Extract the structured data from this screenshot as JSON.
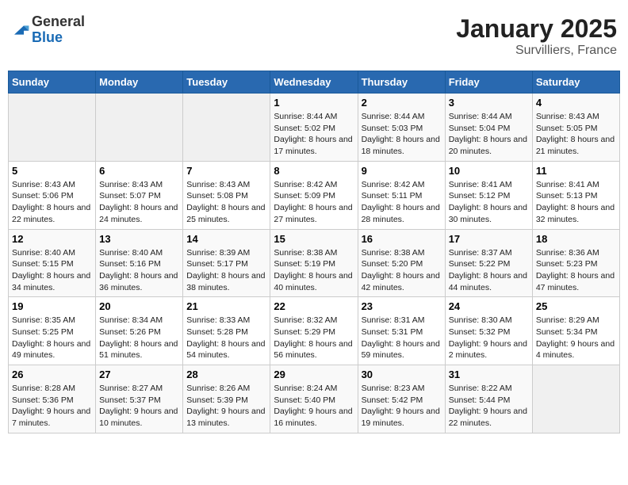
{
  "logo": {
    "line1": "General",
    "line2": "Blue"
  },
  "title": "January 2025",
  "subtitle": "Survilliers, France",
  "weekdays": [
    "Sunday",
    "Monday",
    "Tuesday",
    "Wednesday",
    "Thursday",
    "Friday",
    "Saturday"
  ],
  "weeks": [
    [
      {
        "num": "",
        "info": ""
      },
      {
        "num": "",
        "info": ""
      },
      {
        "num": "",
        "info": ""
      },
      {
        "num": "1",
        "info": "Sunrise: 8:44 AM\nSunset: 5:02 PM\nDaylight: 8 hours and 17 minutes."
      },
      {
        "num": "2",
        "info": "Sunrise: 8:44 AM\nSunset: 5:03 PM\nDaylight: 8 hours and 18 minutes."
      },
      {
        "num": "3",
        "info": "Sunrise: 8:44 AM\nSunset: 5:04 PM\nDaylight: 8 hours and 20 minutes."
      },
      {
        "num": "4",
        "info": "Sunrise: 8:43 AM\nSunset: 5:05 PM\nDaylight: 8 hours and 21 minutes."
      }
    ],
    [
      {
        "num": "5",
        "info": "Sunrise: 8:43 AM\nSunset: 5:06 PM\nDaylight: 8 hours and 22 minutes."
      },
      {
        "num": "6",
        "info": "Sunrise: 8:43 AM\nSunset: 5:07 PM\nDaylight: 8 hours and 24 minutes."
      },
      {
        "num": "7",
        "info": "Sunrise: 8:43 AM\nSunset: 5:08 PM\nDaylight: 8 hours and 25 minutes."
      },
      {
        "num": "8",
        "info": "Sunrise: 8:42 AM\nSunset: 5:09 PM\nDaylight: 8 hours and 27 minutes."
      },
      {
        "num": "9",
        "info": "Sunrise: 8:42 AM\nSunset: 5:11 PM\nDaylight: 8 hours and 28 minutes."
      },
      {
        "num": "10",
        "info": "Sunrise: 8:41 AM\nSunset: 5:12 PM\nDaylight: 8 hours and 30 minutes."
      },
      {
        "num": "11",
        "info": "Sunrise: 8:41 AM\nSunset: 5:13 PM\nDaylight: 8 hours and 32 minutes."
      }
    ],
    [
      {
        "num": "12",
        "info": "Sunrise: 8:40 AM\nSunset: 5:15 PM\nDaylight: 8 hours and 34 minutes."
      },
      {
        "num": "13",
        "info": "Sunrise: 8:40 AM\nSunset: 5:16 PM\nDaylight: 8 hours and 36 minutes."
      },
      {
        "num": "14",
        "info": "Sunrise: 8:39 AM\nSunset: 5:17 PM\nDaylight: 8 hours and 38 minutes."
      },
      {
        "num": "15",
        "info": "Sunrise: 8:38 AM\nSunset: 5:19 PM\nDaylight: 8 hours and 40 minutes."
      },
      {
        "num": "16",
        "info": "Sunrise: 8:38 AM\nSunset: 5:20 PM\nDaylight: 8 hours and 42 minutes."
      },
      {
        "num": "17",
        "info": "Sunrise: 8:37 AM\nSunset: 5:22 PM\nDaylight: 8 hours and 44 minutes."
      },
      {
        "num": "18",
        "info": "Sunrise: 8:36 AM\nSunset: 5:23 PM\nDaylight: 8 hours and 47 minutes."
      }
    ],
    [
      {
        "num": "19",
        "info": "Sunrise: 8:35 AM\nSunset: 5:25 PM\nDaylight: 8 hours and 49 minutes."
      },
      {
        "num": "20",
        "info": "Sunrise: 8:34 AM\nSunset: 5:26 PM\nDaylight: 8 hours and 51 minutes."
      },
      {
        "num": "21",
        "info": "Sunrise: 8:33 AM\nSunset: 5:28 PM\nDaylight: 8 hours and 54 minutes."
      },
      {
        "num": "22",
        "info": "Sunrise: 8:32 AM\nSunset: 5:29 PM\nDaylight: 8 hours and 56 minutes."
      },
      {
        "num": "23",
        "info": "Sunrise: 8:31 AM\nSunset: 5:31 PM\nDaylight: 8 hours and 59 minutes."
      },
      {
        "num": "24",
        "info": "Sunrise: 8:30 AM\nSunset: 5:32 PM\nDaylight: 9 hours and 2 minutes."
      },
      {
        "num": "25",
        "info": "Sunrise: 8:29 AM\nSunset: 5:34 PM\nDaylight: 9 hours and 4 minutes."
      }
    ],
    [
      {
        "num": "26",
        "info": "Sunrise: 8:28 AM\nSunset: 5:36 PM\nDaylight: 9 hours and 7 minutes."
      },
      {
        "num": "27",
        "info": "Sunrise: 8:27 AM\nSunset: 5:37 PM\nDaylight: 9 hours and 10 minutes."
      },
      {
        "num": "28",
        "info": "Sunrise: 8:26 AM\nSunset: 5:39 PM\nDaylight: 9 hours and 13 minutes."
      },
      {
        "num": "29",
        "info": "Sunrise: 8:24 AM\nSunset: 5:40 PM\nDaylight: 9 hours and 16 minutes."
      },
      {
        "num": "30",
        "info": "Sunrise: 8:23 AM\nSunset: 5:42 PM\nDaylight: 9 hours and 19 minutes."
      },
      {
        "num": "31",
        "info": "Sunrise: 8:22 AM\nSunset: 5:44 PM\nDaylight: 9 hours and 22 minutes."
      },
      {
        "num": "",
        "info": ""
      }
    ]
  ]
}
